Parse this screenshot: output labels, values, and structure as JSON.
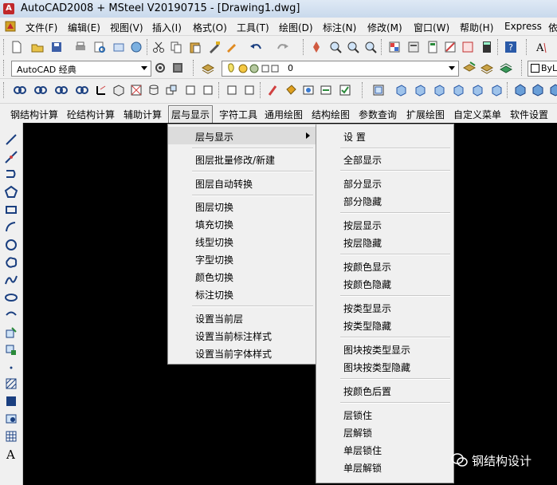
{
  "window": {
    "title": "AutoCAD2008 + MSteel V20190715 - [Drawing1.dwg]"
  },
  "menubar": {
    "items": [
      "文件(F)",
      "编辑(E)",
      "视图(V)",
      "插入(I)",
      "格式(O)",
      "工具(T)",
      "绘图(D)",
      "标注(N)",
      "修改(M)",
      "窗口(W)",
      "帮助(H)",
      "Express",
      "依"
    ]
  },
  "toolbar": {
    "workspace": "AutoCAD 经典",
    "layer": "0",
    "bylayer": "ByL"
  },
  "cmdbar": {
    "items": [
      "钢结构计算",
      "砼结构计算",
      "辅助计算",
      "层与显示",
      "字符工具",
      "通用绘图",
      "结构绘图",
      "参数查询",
      "扩展绘图",
      "自定义菜单",
      "软件设置"
    ]
  },
  "menu1": {
    "items": [
      "层与显示",
      "图层批量修改/新建",
      "图层自动转换",
      "图层切换",
      "填充切换",
      "线型切换",
      "字型切换",
      "颜色切换",
      "标注切换",
      "设置当前层",
      "设置当前标注样式",
      "设置当前字体样式"
    ]
  },
  "menu2": {
    "items": [
      "设 置",
      "全部显示",
      "部分显示",
      "部分隐藏",
      "按层显示",
      "按层隐藏",
      "按颜色显示",
      "按颜色隐藏",
      "按类型显示",
      "按类型隐藏",
      "图块按类型显示",
      "图块按类型隐藏",
      "按颜色后置",
      "层锁住",
      "层解锁",
      "单层锁住",
      "单层解锁"
    ]
  },
  "watermark": {
    "text": "钢结构设计"
  },
  "colors": {
    "canvas": "#000000",
    "menu_bg": "#f0f0f0",
    "highlight": "#dcdcdc"
  }
}
